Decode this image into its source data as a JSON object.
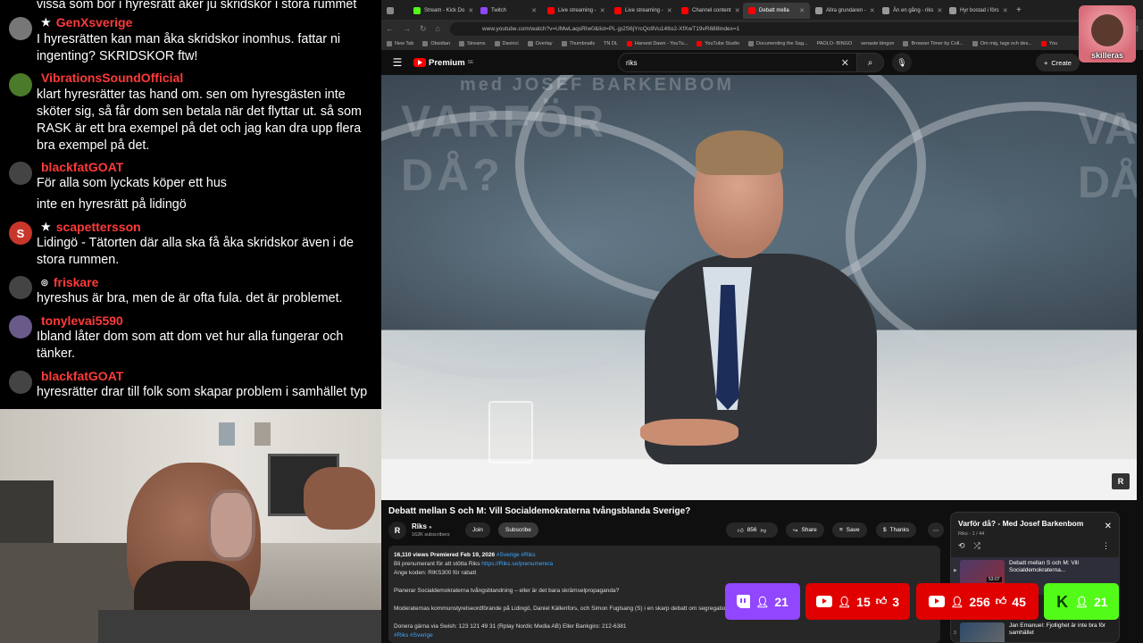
{
  "chat": {
    "messages": [
      {
        "user": "",
        "star": false,
        "text": "vissa som bor i hyresrätt åker ju skridskor i stora rummet",
        "avatar_color": "#555"
      },
      {
        "user": "GenXsverige",
        "star": true,
        "text": "I hyresrätten kan man åka skridskor inomhus. fattar ni ingenting? SKRIDSKOR ftw!",
        "avatar_color": "#777"
      },
      {
        "user": "VibrationsSoundOfficial",
        "star": false,
        "text": "klart hyresrätter tas hand om. sen om hyresgästen inte sköter sig, så får dom sen betala när det flyttar ut. så som RASK är ett bra exempel på det och jag kan dra upp flera bra exempel på det.",
        "avatar_color": "#4a7a2a"
      },
      {
        "user": "blackfatGOAT",
        "star": false,
        "text": "För alla som lyckats köper ett hus",
        "avatar_color": "#444"
      },
      {
        "user": "",
        "star": false,
        "text": "inte en hyresrätt på lidingö",
        "avatar_color": ""
      },
      {
        "user": "scapettersson",
        "star": true,
        "text": "Lidingö - Tätorten där alla ska få åka skridskor även i de stora rummen.",
        "avatar_color": "#c8362b",
        "avatar_letter": "S"
      },
      {
        "user": "friskare",
        "star": false,
        "text": "hyreshus är bra, men de är ofta fula. det är problemet.",
        "avatar_color": "#444"
      },
      {
        "user": "tonylevai5590",
        "star": false,
        "text": "Ibland låter dom som att dom vet hur alla fungerar och tänker.",
        "avatar_color": "#6a5a8a"
      },
      {
        "user": "blackfatGOAT",
        "star": false,
        "text": "hyresrätter drar till folk som skapar problem i samhället typ",
        "avatar_color": "#444"
      }
    ]
  },
  "browser": {
    "tabs": [
      {
        "label": "",
        "color": "#888"
      },
      {
        "label": "Stream - Kick Do",
        "color": "#53fc18"
      },
      {
        "label": "Twitch",
        "color": "#9146ff"
      },
      {
        "label": "Live streaming -",
        "color": "#ff0000"
      },
      {
        "label": "Live streaming -",
        "color": "#ff0000"
      },
      {
        "label": "Channel content",
        "color": "#ff0000"
      },
      {
        "label": "Debatt mella",
        "color": "#ff0000",
        "active": true
      },
      {
        "label": "Allra grundaren -",
        "color": "#999"
      },
      {
        "label": "Än en gång - riks",
        "color": "#999"
      },
      {
        "label": "Hyr bostad i förs",
        "color": "#999"
      }
    ],
    "new_tab": "+",
    "url": "www.youtube.com/watch?v=UMwLaqsRIw0&list=PL-jp2S6jYrcQo9Vu14Ito2-XfXwT19vR688index=1",
    "bookmarks": [
      "New Tab",
      "Obsidian",
      "Streams",
      "Davinci",
      "Overlay",
      "Thumbnails",
      "TN DL",
      "Harvest Dawn - YouTu...",
      "YouTube Studio",
      "Documenting the Sag...",
      "PAOLO- BINGO",
      "senaste bingon",
      "Browser Timer by Coll...",
      "Om mig, tags och des...",
      "You"
    ]
  },
  "youtube": {
    "logo": "Premium",
    "logo_region": "SE",
    "search_value": "riks",
    "create_label": "Create",
    "video": {
      "overlay_top": "med JOSEF BARKENBOM",
      "overlay_title_1": "VARFÖR",
      "overlay_title_2": "DÅ?",
      "overlay_right": "VA DÅ",
      "corner_logo": "R"
    },
    "title": "Debatt mellan S och M: Vill Socialdemokraterna tvångsblanda Sverige?",
    "channel": {
      "name": "Riks",
      "subscribers": "162K subscribers",
      "avatar_letter": "R"
    },
    "join_label": "Join",
    "subscribe_label": "Subscribe",
    "likes": "856",
    "share_label": "Share",
    "save_label": "Save",
    "thanks_label": "Thanks",
    "description": {
      "meta": "16,110 views  Premiered Feb 19, 2026",
      "tags_top": "#Sverige #Riks",
      "line1": "Bli prenumerant för att stötta Riks",
      "link1": "https://Riks.se/prenumerera",
      "line2": "Ange koden: RIKS300 för rabatt",
      "line3": "Planerar Socialdemokraterna tvångsblandning – eller är det bara skrämselpropaganda?",
      "line4": "Moderaternas kommunstyrelseordförande på Lidingö, Daniel Källenfors, och Simon Fuglsang (S) i en skarp debatt om segregation i",
      "line5": "Donera gärna via Swish: 123 121 49 31 (Rplay Nordic Media AB) Eller Bankgiro: 212-6381",
      "tags_bottom": "#Riks #Sverige"
    },
    "playlist": {
      "title": "Varför då? - Med Josef Barkenbom",
      "sub": "Riks - 1 / 44",
      "items": [
        {
          "index": "▶",
          "title": "Debatt mellan S och M: Vill Socialdemokraterna...",
          "duration": "53:07",
          "active": true
        },
        {
          "index": "3",
          "title": "Jan Emanuel: Fjollighet är inte bra för samhället",
          "duration": "",
          "active": false
        }
      ]
    }
  },
  "counters": [
    {
      "platform": "twitch",
      "viewers": "21",
      "likes": "",
      "color": "#9146ff"
    },
    {
      "platform": "youtube",
      "viewers": "15",
      "likes": "3",
      "color": "#e00000"
    },
    {
      "platform": "youtube",
      "viewers": "256",
      "likes": "45",
      "color": "#e00000"
    },
    {
      "platform": "kick",
      "viewers": "21",
      "likes": "",
      "color": "#53fc18"
    }
  ],
  "streamer_avatar": {
    "label": "skilleras"
  }
}
